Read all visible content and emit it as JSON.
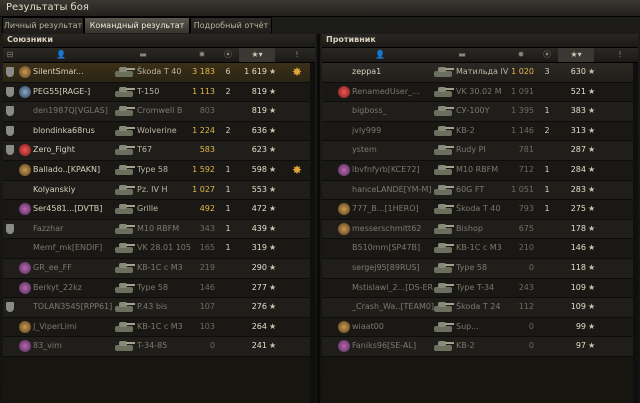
{
  "window": {
    "title": "Результаты боя"
  },
  "tabs": [
    {
      "label": "Личный результат",
      "active": false
    },
    {
      "label": "Командный результат",
      "active": true
    },
    {
      "label": "Подробный отчёт",
      "active": false
    }
  ],
  "allies": {
    "title": "Союзники",
    "rows": [
      {
        "badge": true,
        "emblem": "gold",
        "name": "SilentSmar...",
        "vehicle": "Škoda T 40",
        "damage": "3 183",
        "kills": "6",
        "xp": "1 619",
        "medal": true,
        "dead": false
      },
      {
        "badge": true,
        "emblem": "blue",
        "name": "PEG55[RAGE-]",
        "vehicle": "T-150",
        "damage": "1 113",
        "kills": "2",
        "xp": "819",
        "medal": false,
        "dead": false
      },
      {
        "badge": true,
        "emblem": "",
        "name": "den1987Q[VGLAS]",
        "vehicle": "Cromwell B",
        "damage": "803",
        "kills": "",
        "xp": "819",
        "medal": false,
        "dead": true
      },
      {
        "badge": true,
        "emblem": "",
        "name": "blondinka68rus",
        "vehicle": "Wolverine",
        "damage": "1 224",
        "kills": "2",
        "xp": "636",
        "medal": false,
        "dead": false
      },
      {
        "badge": true,
        "emblem": "red",
        "name": "Zero_Fight",
        "vehicle": "T67",
        "damage": "583",
        "kills": "",
        "xp": "623",
        "medal": false,
        "dead": false
      },
      {
        "badge": false,
        "emblem": "gold",
        "name": "Ballado..[KPAKN]",
        "vehicle": "Type 58",
        "damage": "1 592",
        "kills": "1",
        "xp": "598",
        "medal": true,
        "dead": false
      },
      {
        "badge": false,
        "emblem": "",
        "name": "Kolyanskiy",
        "vehicle": "Pz. IV H",
        "damage": "1 027",
        "kills": "1",
        "xp": "553",
        "medal": false,
        "dead": false
      },
      {
        "badge": false,
        "emblem": "purple",
        "name": "Ser4581...[DVTB]",
        "vehicle": "Grille",
        "damage": "492",
        "kills": "1",
        "xp": "472",
        "medal": false,
        "dead": false
      },
      {
        "badge": true,
        "emblem": "",
        "name": "Fazzhar",
        "vehicle": "M10 RBFM",
        "damage": "343",
        "kills": "1",
        "xp": "439",
        "medal": false,
        "dead": true
      },
      {
        "badge": false,
        "emblem": "",
        "name": "Memf_mk[ENDIF]",
        "vehicle": "VK 28.01 105",
        "damage": "165",
        "kills": "1",
        "xp": "319",
        "medal": false,
        "dead": true
      },
      {
        "badge": false,
        "emblem": "purple",
        "name": "GR_ee_FF",
        "vehicle": "KB-1C с M3",
        "damage": "219",
        "kills": "",
        "xp": "290",
        "medal": false,
        "dead": true
      },
      {
        "badge": false,
        "emblem": "purple",
        "name": "Berkyt_22kz",
        "vehicle": "Type 58",
        "damage": "146",
        "kills": "",
        "xp": "277",
        "medal": false,
        "dead": true
      },
      {
        "badge": true,
        "emblem": "",
        "name": "TOLAN3545[RPP61]",
        "vehicle": "P.43 bis",
        "damage": "107",
        "kills": "",
        "xp": "276",
        "medal": false,
        "dead": true
      },
      {
        "badge": false,
        "emblem": "gold",
        "name": "J_ViperLimi",
        "vehicle": "KB-1C с M3",
        "damage": "103",
        "kills": "",
        "xp": "264",
        "medal": false,
        "dead": true
      },
      {
        "badge": false,
        "emblem": "purple",
        "name": "83_vim",
        "vehicle": "T-34-85",
        "damage": "0",
        "kills": "",
        "xp": "241",
        "medal": false,
        "dead": true
      }
    ]
  },
  "enemies": {
    "title": "Противник",
    "rows": [
      {
        "emblem": "",
        "name": "zeppa1",
        "vehicle": "Матильда IV",
        "damage": "1 020",
        "kills": "3",
        "xp": "630",
        "dead": false
      },
      {
        "emblem": "red",
        "name": "RenamedUser_...",
        "vehicle": "VK 30.02 M",
        "damage": "1 091",
        "kills": "",
        "xp": "521",
        "dead": true
      },
      {
        "emblem": "",
        "name": "bigboss_",
        "vehicle": "СУ-100Y",
        "damage": "1 395",
        "kills": "1",
        "xp": "383",
        "dead": true
      },
      {
        "emblem": "",
        "name": "jvly999",
        "vehicle": "KB-2",
        "damage": "1 146",
        "kills": "2",
        "xp": "313",
        "dead": true
      },
      {
        "emblem": "",
        "name": "ystem",
        "vehicle": "Rudy PI",
        "damage": "781",
        "kills": "",
        "xp": "287",
        "dead": true
      },
      {
        "emblem": "purple",
        "name": "lbvfnfyrb[KCE72]",
        "vehicle": "M10 RBFM",
        "damage": "712",
        "kills": "1",
        "xp": "284",
        "dead": true
      },
      {
        "emblem": "",
        "name": "hanceLANDE[YM-M]",
        "vehicle": "60G FT",
        "damage": "1 051",
        "kills": "1",
        "xp": "283",
        "dead": true
      },
      {
        "emblem": "gold",
        "name": "777_B...[1HERO]",
        "vehicle": "Škoda T 40",
        "damage": "793",
        "kills": "1",
        "xp": "275",
        "dead": true
      },
      {
        "emblem": "gold",
        "name": "messerschmitt62",
        "vehicle": "Bishop",
        "damage": "675",
        "kills": "",
        "xp": "178",
        "dead": true
      },
      {
        "emblem": "",
        "name": "B510mm[SP47B]",
        "vehicle": "KB-1C с M3",
        "damage": "210",
        "kills": "",
        "xp": "146",
        "dead": true
      },
      {
        "emblem": "",
        "name": "sergej95[89RUS]",
        "vehicle": "Type 58",
        "damage": "0",
        "kills": "",
        "xp": "118",
        "dead": true
      },
      {
        "emblem": "",
        "name": "Mstislawl_2...[DS-ER]",
        "vehicle": "Type T-34",
        "damage": "243",
        "kills": "",
        "xp": "109",
        "dead": true
      },
      {
        "emblem": "",
        "name": "_Crash_Wa..[TEAM0]",
        "vehicle": "Škoda T 24",
        "damage": "112",
        "kills": "",
        "xp": "109",
        "dead": true
      },
      {
        "emblem": "gold",
        "name": "wiaat00",
        "vehicle": "Sup...",
        "damage": "0",
        "kills": "",
        "xp": "99",
        "dead": true
      },
      {
        "emblem": "purple",
        "name": "Faniks96[SE-AL]",
        "vehicle": "KB-2",
        "damage": "0",
        "kills": "",
        "xp": "97",
        "dead": true
      }
    ]
  },
  "colors": {
    "damage": "#e2b84a",
    "accent": "#3a3832"
  }
}
